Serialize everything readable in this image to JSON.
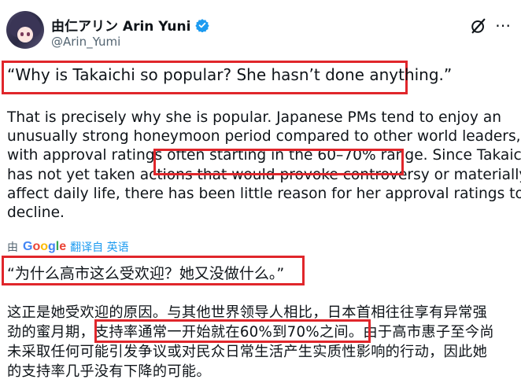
{
  "author": {
    "display_name": "由仁アリン Arin Yuni",
    "handle": "@Arin_Yumi",
    "verified": true
  },
  "original": {
    "quote": "“Why is Takaichi so popular? She hasn’t done anything.”",
    "lines": [
      "That is precisely why she is popular. Japanese PMs tend to enjoy an",
      "unusually strong honeymoon period compared to other world leaders,"
    ],
    "line3_before": "with approval ratings ",
    "line3_highlight": "often starting in the 60–70% range.",
    "line3_after": " Since Takaichi",
    "lines_after": [
      "has not yet taken actions that would provoke controversy or materially",
      "affect daily life, there has been little reason for her approval ratings to",
      "decline."
    ]
  },
  "translation": {
    "by_label": "由",
    "provider": "Google",
    "action_label": "翻译自 英语",
    "quote": "“为什么高市这么受欢迎？她又没做什么。”",
    "line1": "这正是她受欢迎的原因。与其他世界领导人相比，日本首相往往享有异常强",
    "line2_before": "劲的蜜月期，",
    "line2_highlight": "支持率通常一开始就在60%到70%之间。",
    "line2_after": "由于高市惠子至今尚",
    "line3": "未采取任何可能引发争议或对民众日常生活产生实质性影响的行动，因此她",
    "line4": "的支持率几乎没有下降的可能。"
  },
  "colors": {
    "highlight_box": "#e0262b",
    "link": "#1d9bf0",
    "secondary_text": "#536471",
    "verified_badge": "#1d9bf0"
  },
  "icons": [
    "grok-icon",
    "more-icon",
    "verified-badge-icon"
  ]
}
